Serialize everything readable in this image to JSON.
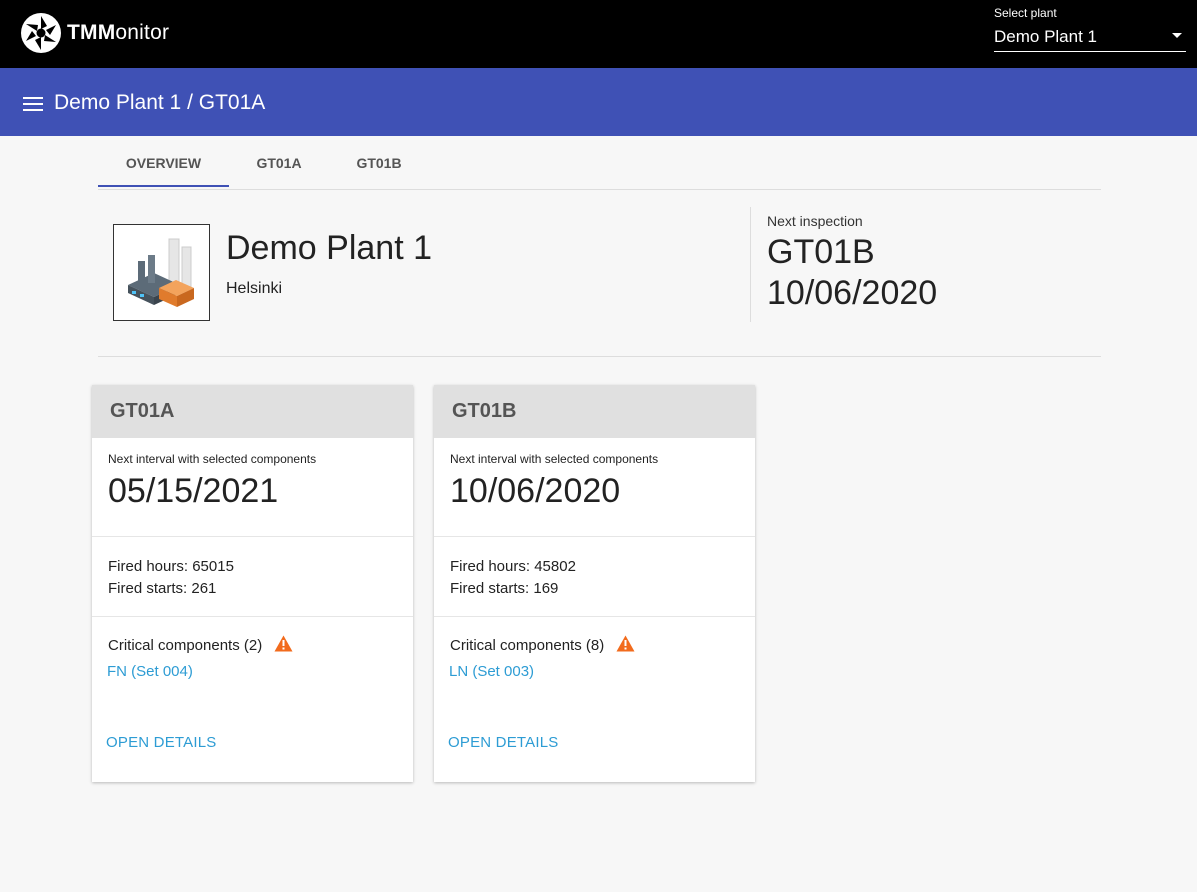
{
  "brand": {
    "bold": "TMM",
    "rest": "onitor"
  },
  "plant_select": {
    "label": "Select plant",
    "value": "Demo Plant 1"
  },
  "header": {
    "title": "Demo Plant 1 / GT01A"
  },
  "tabs": [
    {
      "label": "OVERVIEW",
      "active": true
    },
    {
      "label": "GT01A"
    },
    {
      "label": "GT01B"
    }
  ],
  "plant": {
    "name": "Demo Plant 1",
    "city": "Helsinki"
  },
  "next_inspection": {
    "label": "Next inspection",
    "unit": "GT01B",
    "date": "10/06/2020"
  },
  "cards": [
    {
      "title": "GT01A",
      "interval_label": "Next interval with selected components",
      "interval_date": "05/15/2021",
      "fired_hours": "Fired hours: 65015",
      "fired_starts": "Fired starts: 261",
      "critical": "Critical components (2)",
      "component_link": "FN (Set 004)",
      "open_details": "OPEN DETAILS"
    },
    {
      "title": "GT01B",
      "interval_label": "Next interval with selected components",
      "interval_date": "10/06/2020",
      "fired_hours": "Fired hours: 45802",
      "fired_starts": "Fired starts: 169",
      "critical": "Critical components (8)",
      "component_link": "LN (Set 003)",
      "open_details": "OPEN DETAILS"
    }
  ],
  "colors": {
    "appbar": "#3f51b5",
    "link": "#2d9cd4",
    "warning": "#f26b1d"
  },
  "icons": {
    "logo": "aperture-logo-icon",
    "menu": "hamburger-menu-icon",
    "dropdown": "dropdown-arrow-icon",
    "warning": "warning-triangle-icon",
    "plant": "factory-illustration-icon"
  }
}
